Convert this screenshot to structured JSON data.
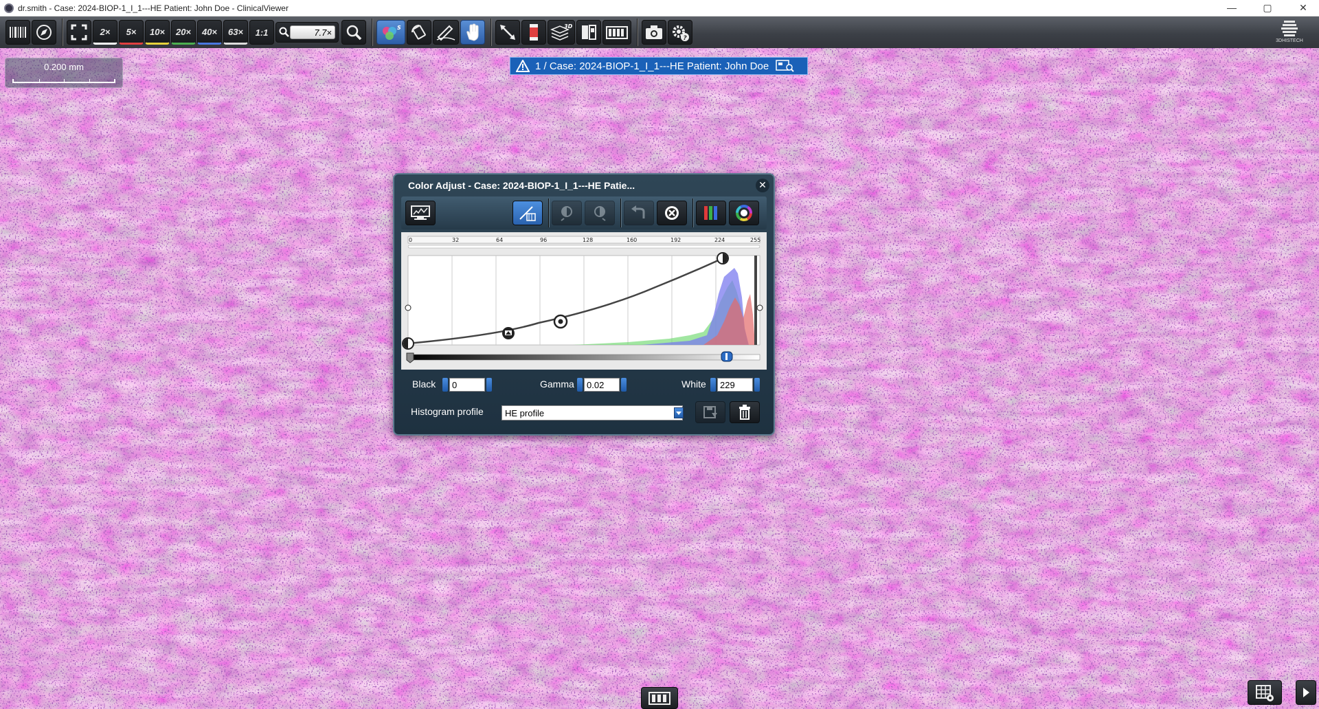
{
  "window": {
    "title": "dr.smith - Case: 2024-BIOP-1_I_1---HE Patient: John Doe - ClinicalViewer",
    "controls": {
      "minimize": "—",
      "maximize": "▢",
      "close": "✕"
    }
  },
  "toolbar": {
    "magnifications": [
      {
        "label": "2×",
        "color": "#ffffff"
      },
      {
        "label": "5×",
        "color": "#e04040"
      },
      {
        "label": "10×",
        "color": "#e6d23c"
      },
      {
        "label": "20×",
        "color": "#4caf50"
      },
      {
        "label": "40×",
        "color": "#4a78e0"
      },
      {
        "label": "63×",
        "color": "#dddddd"
      }
    ],
    "one_to_one_label": "1:1",
    "zoom_value": "7.7×",
    "logo_text": "3DHISTECH"
  },
  "scale_bar": {
    "label": "0.200 mm"
  },
  "case_banner": {
    "text": "1 / Case: 2024-BIOP-1_I_1---HE Patient: John Doe"
  },
  "color_adjust": {
    "title": "Color Adjust - Case: 2024-BIOP-1_I_1---HE Patie...",
    "close_label": "✕",
    "ruler_ticks": [
      "0",
      "32",
      "64",
      "96",
      "128",
      "160",
      "192",
      "224",
      "255"
    ],
    "black_label": "Black",
    "black_value": "0",
    "gamma_label": "Gamma",
    "gamma_value": "0.02",
    "white_label": "White",
    "white_value": "229",
    "profile_label": "Histogram profile",
    "profile_value": "HE profile"
  }
}
